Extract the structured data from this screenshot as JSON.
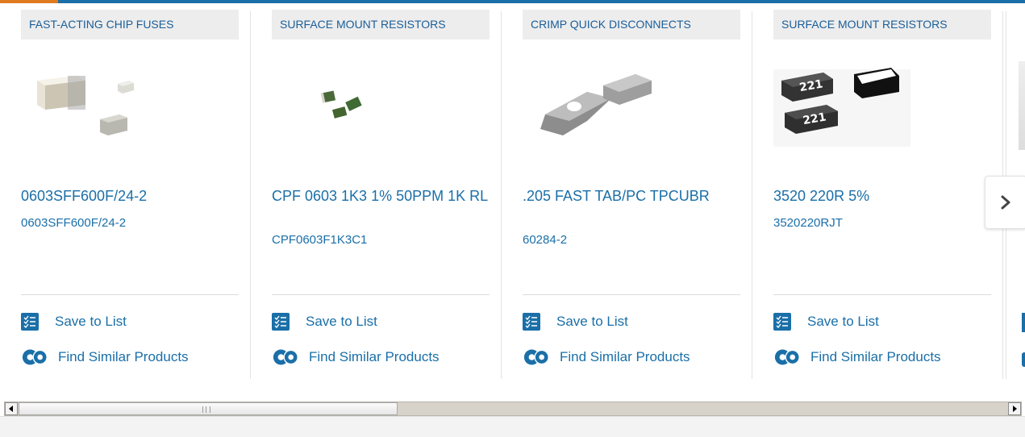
{
  "products": [
    {
      "category": "FAST-ACTING CHIP FUSES",
      "title": "0603SFF600F/24-2",
      "sku": "0603SFF600F/24-2",
      "image": "chip-fuse-image"
    },
    {
      "category": "SURFACE MOUNT RESISTORS",
      "title": "CPF 0603 1K3 1% 50PPM 1K RL",
      "sku": "CPF0603F1K3C1",
      "image": "smd-resistor-image"
    },
    {
      "category": "CRIMP QUICK DISCONNECTS",
      "title": ".205 FAST TAB/PC TPCUBR",
      "sku": "60284-2",
      "image": "quick-disconnect-image"
    },
    {
      "category": "SURFACE MOUNT RESISTORS",
      "title": "3520 220R 5%",
      "sku": "3520220RJT",
      "image": "resistor-221-image",
      "marking": "221"
    }
  ],
  "actions": {
    "save_label": "Save to List",
    "similar_label": "Find Similar Products"
  },
  "icons": {
    "save": "checklist-icon",
    "similar": "gear-icon",
    "next": "chevron-right-icon"
  },
  "colors": {
    "link": "#1a6fa8",
    "accent_bar": "#1a6fa8",
    "accent_orange": "#e07a1f",
    "category_bg": "#ededed"
  }
}
